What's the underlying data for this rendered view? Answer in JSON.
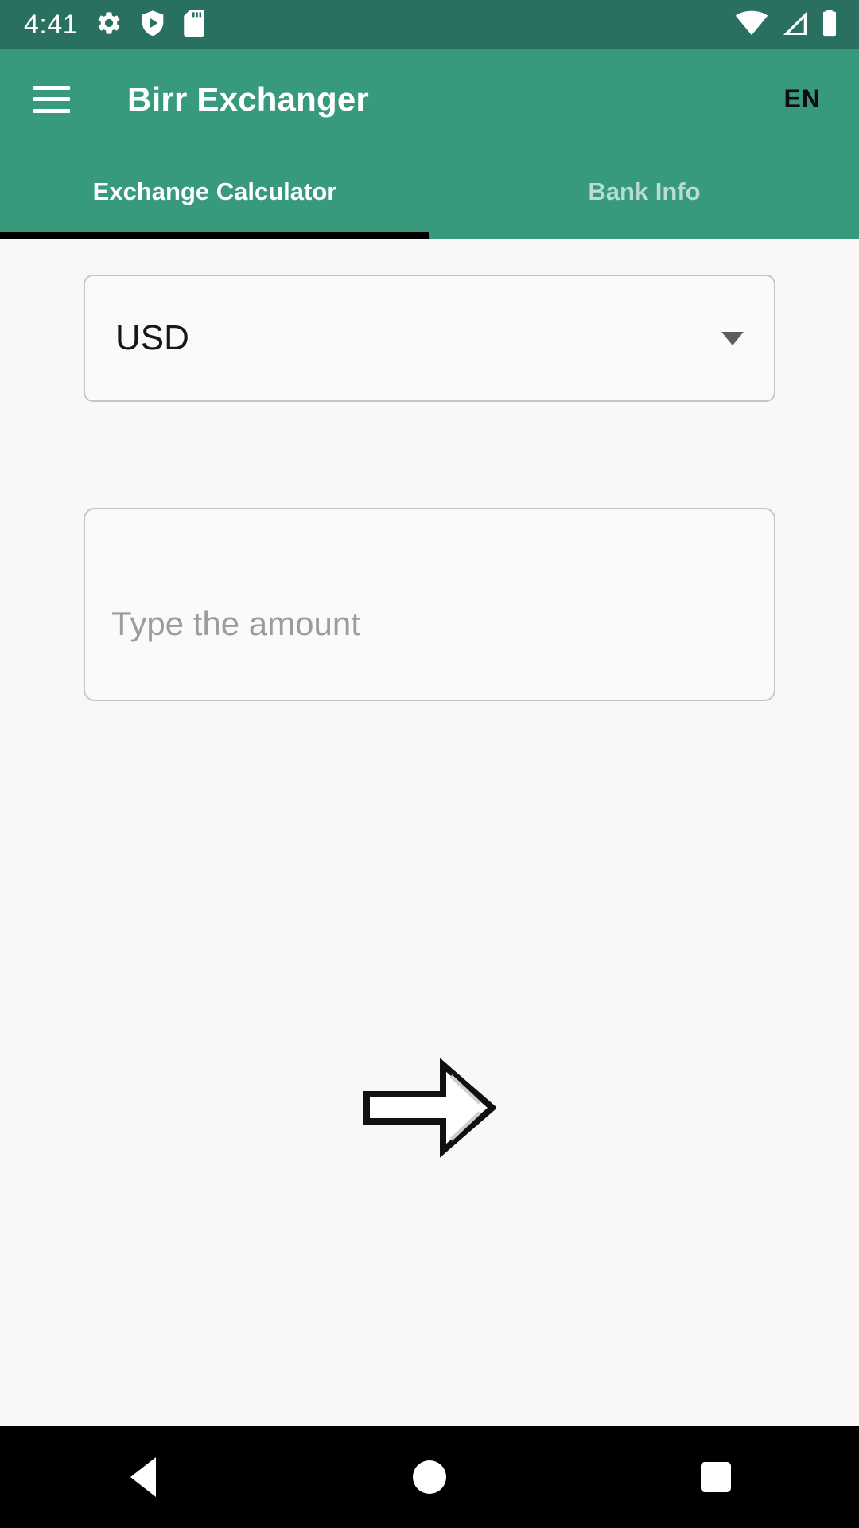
{
  "status_bar": {
    "time": "4:41",
    "left_icons": [
      "gear-icon",
      "play-protect-shield-icon",
      "sd-card-icon"
    ],
    "right_icons": [
      "wifi-icon",
      "cellular-signal-icon",
      "battery-icon"
    ],
    "background_color": "#2a7060"
  },
  "app_bar": {
    "menu_icon": "hamburger-menu-icon",
    "title": "Birr Exchanger",
    "language_label": "EN",
    "background_color": "#379a7c"
  },
  "tabs": {
    "items": [
      {
        "label": "Exchange Calculator",
        "active": true
      },
      {
        "label": "Bank Info",
        "active": false
      }
    ],
    "indicator_color": "#000000"
  },
  "main": {
    "currency_select": {
      "value": "USD",
      "caret_icon": "chevron-down-icon"
    },
    "amount_input": {
      "value": "",
      "placeholder": "Type the amount"
    },
    "arrow_icon": "right-arrow-icon",
    "background_color": "#f8f8f8"
  },
  "nav_bar": {
    "buttons": [
      {
        "name": "back",
        "icon": "back-triangle-icon"
      },
      {
        "name": "home",
        "icon": "home-circle-icon"
      },
      {
        "name": "recents",
        "icon": "recents-square-icon"
      }
    ],
    "background_color": "#000000"
  }
}
